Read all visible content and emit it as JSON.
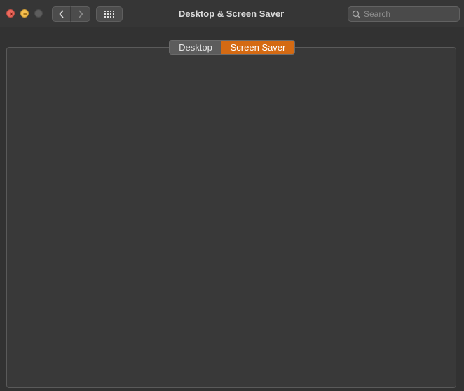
{
  "window": {
    "title": "Desktop & Screen Saver"
  },
  "search": {
    "placeholder": "Search"
  },
  "tabs": [
    {
      "label": "Desktop",
      "selected": false
    },
    {
      "label": "Screen Saver",
      "selected": true
    }
  ],
  "colors": {
    "accent": "#d46a13",
    "close": "#ed6a5e",
    "minimize": "#f5bf4f",
    "zoom_disabled": "#5d5d5d"
  },
  "icons": {
    "back": "chevron-left-icon",
    "forward": "chevron-right-icon",
    "show_all": "grid-icon",
    "search": "search-icon"
  }
}
